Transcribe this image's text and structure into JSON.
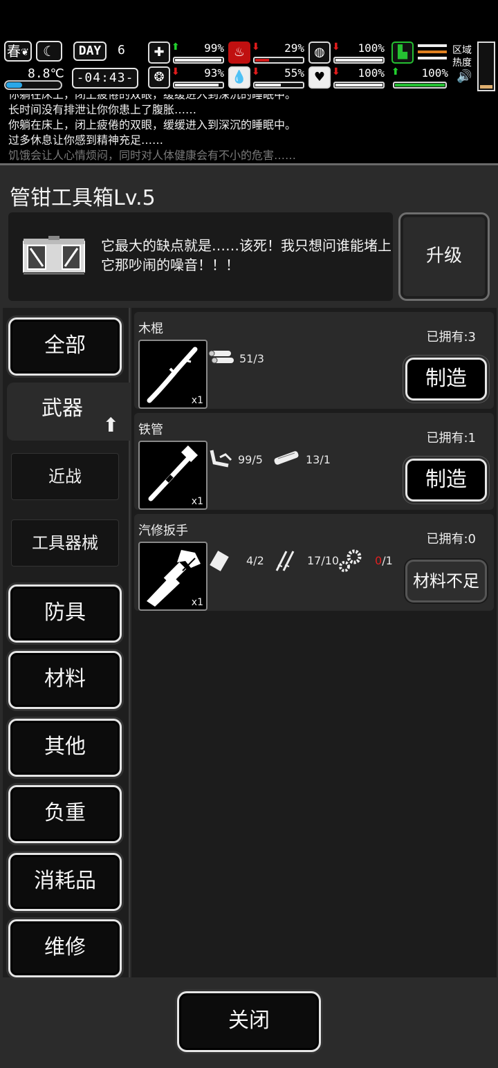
{
  "hud": {
    "season": "春",
    "temperature": "8.8℃",
    "temperature_level": 0.3,
    "day_label": "DAY",
    "day_number": "6",
    "clock": "-04:43-",
    "stats": [
      {
        "icon": "medkit-icon",
        "trend": "up",
        "value": "99%",
        "level": 0.99,
        "bar": "white"
      },
      {
        "icon": "stomach-icon",
        "trend": "down",
        "value": "29%",
        "level": 0.29,
        "bar": "red"
      },
      {
        "icon": "bladder-icon",
        "trend": "down",
        "value": "100%",
        "level": 1.0,
        "bar": "white"
      },
      {
        "icon": "brain-icon",
        "trend": "down",
        "value": "93%",
        "level": 0.93,
        "bar": "white"
      },
      {
        "icon": "water-drop-icon",
        "trend": "down",
        "value": "55%",
        "level": 0.55,
        "bar": "white"
      },
      {
        "icon": "heart-icon",
        "trend": "down",
        "value": "100%",
        "level": 1.0,
        "bar": "white"
      },
      {
        "icon": "stamina-icon",
        "trend": "up",
        "value": "100%",
        "level": 1.0,
        "bar": "green"
      }
    ],
    "zone_label": "区域热度",
    "zone_level": 0.08,
    "colors": {
      "up": "#22d02e",
      "down": "#e01c1c",
      "thermo": "#2aa7e8"
    }
  },
  "log": [
    "你躺在床上，闭上疲倦的双眼，缓缓进入到深沉的睡眠中。",
    "长时间没有排泄让你你患上了腹胀……",
    "你躺在床上，闭上疲倦的双眼，缓缓进入到深沉的睡眠中。",
    "过多休息让你感到精神充足……",
    "饥饿会让人心情烦闷，同时对人体健康会有不小的危害……"
  ],
  "panel": {
    "title": "管钳工具箱Lv.5",
    "description": "它最大的缺点就是……该死！我只想问谁能堵上它那吵闹的噪音！！！",
    "upgrade_label": "升级"
  },
  "categories": [
    {
      "id": "all",
      "label": "全部"
    },
    {
      "id": "weapons",
      "label": "武器",
      "active": true
    },
    {
      "id": "melee",
      "label": "近战",
      "sub": true
    },
    {
      "id": "tools",
      "label": "工具器械",
      "sub": true
    },
    {
      "id": "armor",
      "label": "防具"
    },
    {
      "id": "materials",
      "label": "材料"
    },
    {
      "id": "other",
      "label": "其他"
    },
    {
      "id": "load",
      "label": "负重"
    },
    {
      "id": "consumables",
      "label": "消耗品"
    },
    {
      "id": "repair",
      "label": "维修"
    }
  ],
  "items": [
    {
      "name": "木棍",
      "owned": "已拥有:3",
      "qty": "x1",
      "action": "制造",
      "enabled": true,
      "materials": [
        {
          "icon": "wood-logs-icon",
          "have": "51",
          "need": "3",
          "sufficient": true
        }
      ]
    },
    {
      "name": "铁管",
      "owned": "已拥有:1",
      "qty": "x1",
      "action": "制造",
      "enabled": true,
      "materials": [
        {
          "icon": "scrap-pipe-icon",
          "have": "99",
          "need": "5",
          "sufficient": true
        },
        {
          "icon": "wood-plank-icon",
          "have": "13",
          "need": "1",
          "sufficient": true
        }
      ]
    },
    {
      "name": "汽修扳手",
      "owned": "已拥有:0",
      "qty": "x1",
      "action": "材料不足",
      "enabled": false,
      "materials": [
        {
          "icon": "metal-sheet-icon",
          "have": "4",
          "need": "2",
          "sufficient": true
        },
        {
          "icon": "screws-icon",
          "have": "17",
          "need": "10",
          "sufficient": true
        },
        {
          "icon": "gears-icon",
          "have": "0",
          "need": "1",
          "sufficient": false
        }
      ]
    }
  ],
  "close_label": "关闭"
}
